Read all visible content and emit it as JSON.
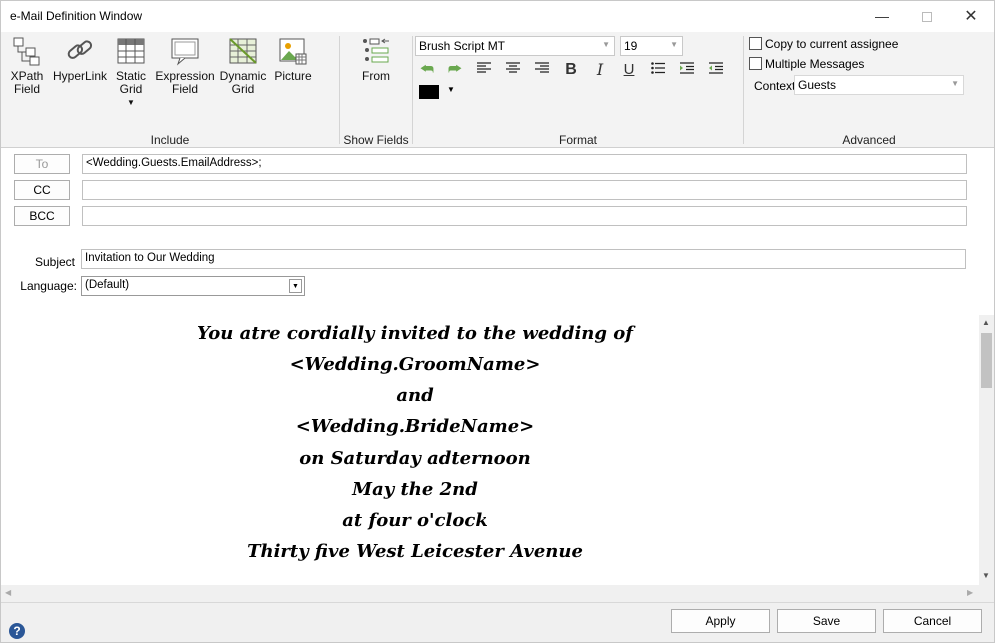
{
  "window": {
    "title": "e-Mail Definition Window",
    "min_icon": "minimize-icon",
    "max_icon": "maximize-icon",
    "close_icon": "close-icon"
  },
  "ribbon": {
    "include": {
      "label": "Include",
      "buttons": [
        {
          "l1": "XPath",
          "l2": "Field"
        },
        {
          "l1": "HyperLink",
          "l2": ""
        },
        {
          "l1": "Static",
          "l2": "Grid"
        },
        {
          "l1": "Expression",
          "l2": "Field"
        },
        {
          "l1": "Dynamic",
          "l2": "Grid"
        },
        {
          "l1": "Picture",
          "l2": ""
        }
      ]
    },
    "show_fields": {
      "label": "Show Fields",
      "from_label": "From"
    },
    "format": {
      "label": "Format",
      "font": "Brush Script MT",
      "size": "19",
      "text_color": "#000000"
    },
    "advanced": {
      "label": "Advanced",
      "copy_assignee": "Copy to current assignee",
      "multiple_messages": "Multiple Messages",
      "context_label": "Context",
      "context_value": "Guests"
    }
  },
  "form": {
    "to_label": "To",
    "to_value": "<Wedding.Guests.EmailAddress>;",
    "cc_label": "CC",
    "cc_value": "",
    "bcc_label": "BCC",
    "bcc_value": "",
    "subject_label": "Subject",
    "subject_value": "Invitation to Our Wedding",
    "language_label": "Language:",
    "language_value": "(Default)"
  },
  "editor": {
    "lines": [
      "You atre cordially invited to the wedding of",
      "<Wedding.GroomName>",
      "and",
      "<Wedding.BrideName>",
      "on Saturday adternoon",
      "May the 2nd",
      "at four o'clock",
      "Thirty five West Leicester Avenue"
    ]
  },
  "footer": {
    "apply": "Apply",
    "save": "Save",
    "cancel": "Cancel",
    "help_icon": "help-icon"
  }
}
